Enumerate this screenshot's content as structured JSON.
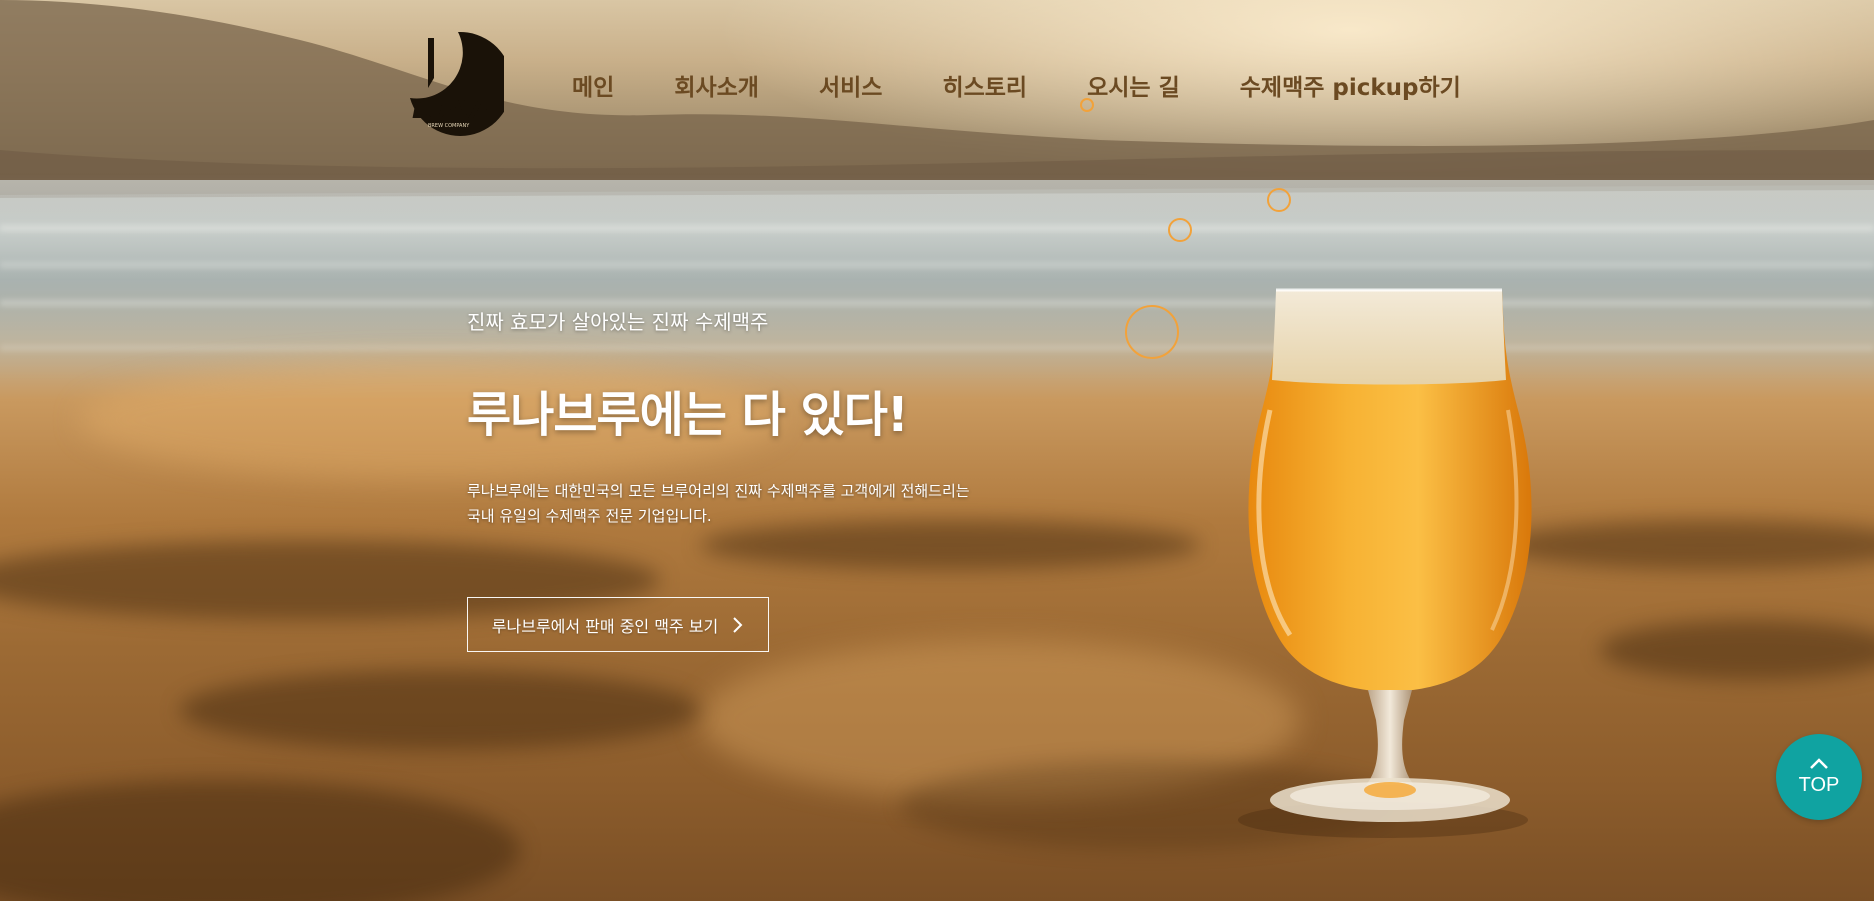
{
  "brand": {
    "logo_text": "LUNA",
    "logo_subtext": "BREW COMPANY"
  },
  "nav": {
    "items": [
      {
        "label": "메인"
      },
      {
        "label": "회사소개"
      },
      {
        "label": "서비스"
      },
      {
        "label": "히스토리"
      },
      {
        "label": "오시는 길"
      },
      {
        "label": "수제맥주 pickup하기"
      }
    ]
  },
  "hero": {
    "subtitle": "진짜 효모가 살아있는 진짜 수제맥주",
    "headline": "루나브루에는 다 있다!",
    "description_lines": [
      "루나브루에는 대한민국의 모든 브루어리의 진짜 수제맥주를 고객에게 전해드리는",
      "국내 유일의 수제맥주 전문 기업입니다."
    ],
    "cta_label": "루나브루에서 판매 중인 맥주 보기",
    "cta_icon": "chevron-right-icon"
  },
  "top_button": {
    "label": "TOP",
    "icon": "chevron-up-icon",
    "color": "#10a3a1"
  },
  "colors": {
    "nav_text": "#6b4a22",
    "bubble": "#f2a23a",
    "beer": "#f5a623"
  }
}
